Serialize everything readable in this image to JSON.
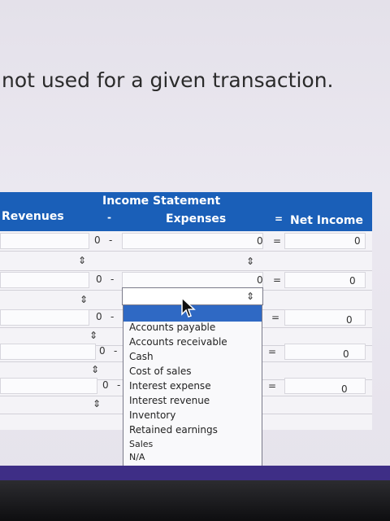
{
  "instruction_text": "not used for a given transaction.",
  "table": {
    "section_title": "Income Statement",
    "col_revenues": "Revenues",
    "col_minus": "-",
    "col_expenses": "Expenses",
    "col_equals": "=",
    "col_net_income": "Net Income",
    "rows": [
      {
        "revenue": "0",
        "minus": "-",
        "expense": "0",
        "equals": "=",
        "net": "0"
      },
      {
        "revenue": "0",
        "minus": "-",
        "expense": "0",
        "equals": "=",
        "net": "0"
      },
      {
        "revenue": "0",
        "minus": "-",
        "expense": "",
        "equals": "=",
        "net": "0"
      },
      {
        "revenue": "0",
        "minus": "-",
        "expense": "",
        "equals": "=",
        "net": "0"
      },
      {
        "revenue": "0",
        "minus": "-",
        "expense": "",
        "equals": "=",
        "net": "0"
      }
    ]
  },
  "dropdown": {
    "selected": "",
    "options": [
      "Accounts payable",
      "Accounts receivable",
      "Cash",
      "Cost of sales",
      "Interest expense",
      "Interest revenue",
      "Inventory",
      "Retained earnings",
      "Sales",
      "N/A"
    ]
  },
  "colors": {
    "header": "#1a5fb8",
    "selection": "#2f69c4"
  },
  "icons": [
    "up-down-stepper-icon",
    "mouse-pointer-icon"
  ]
}
